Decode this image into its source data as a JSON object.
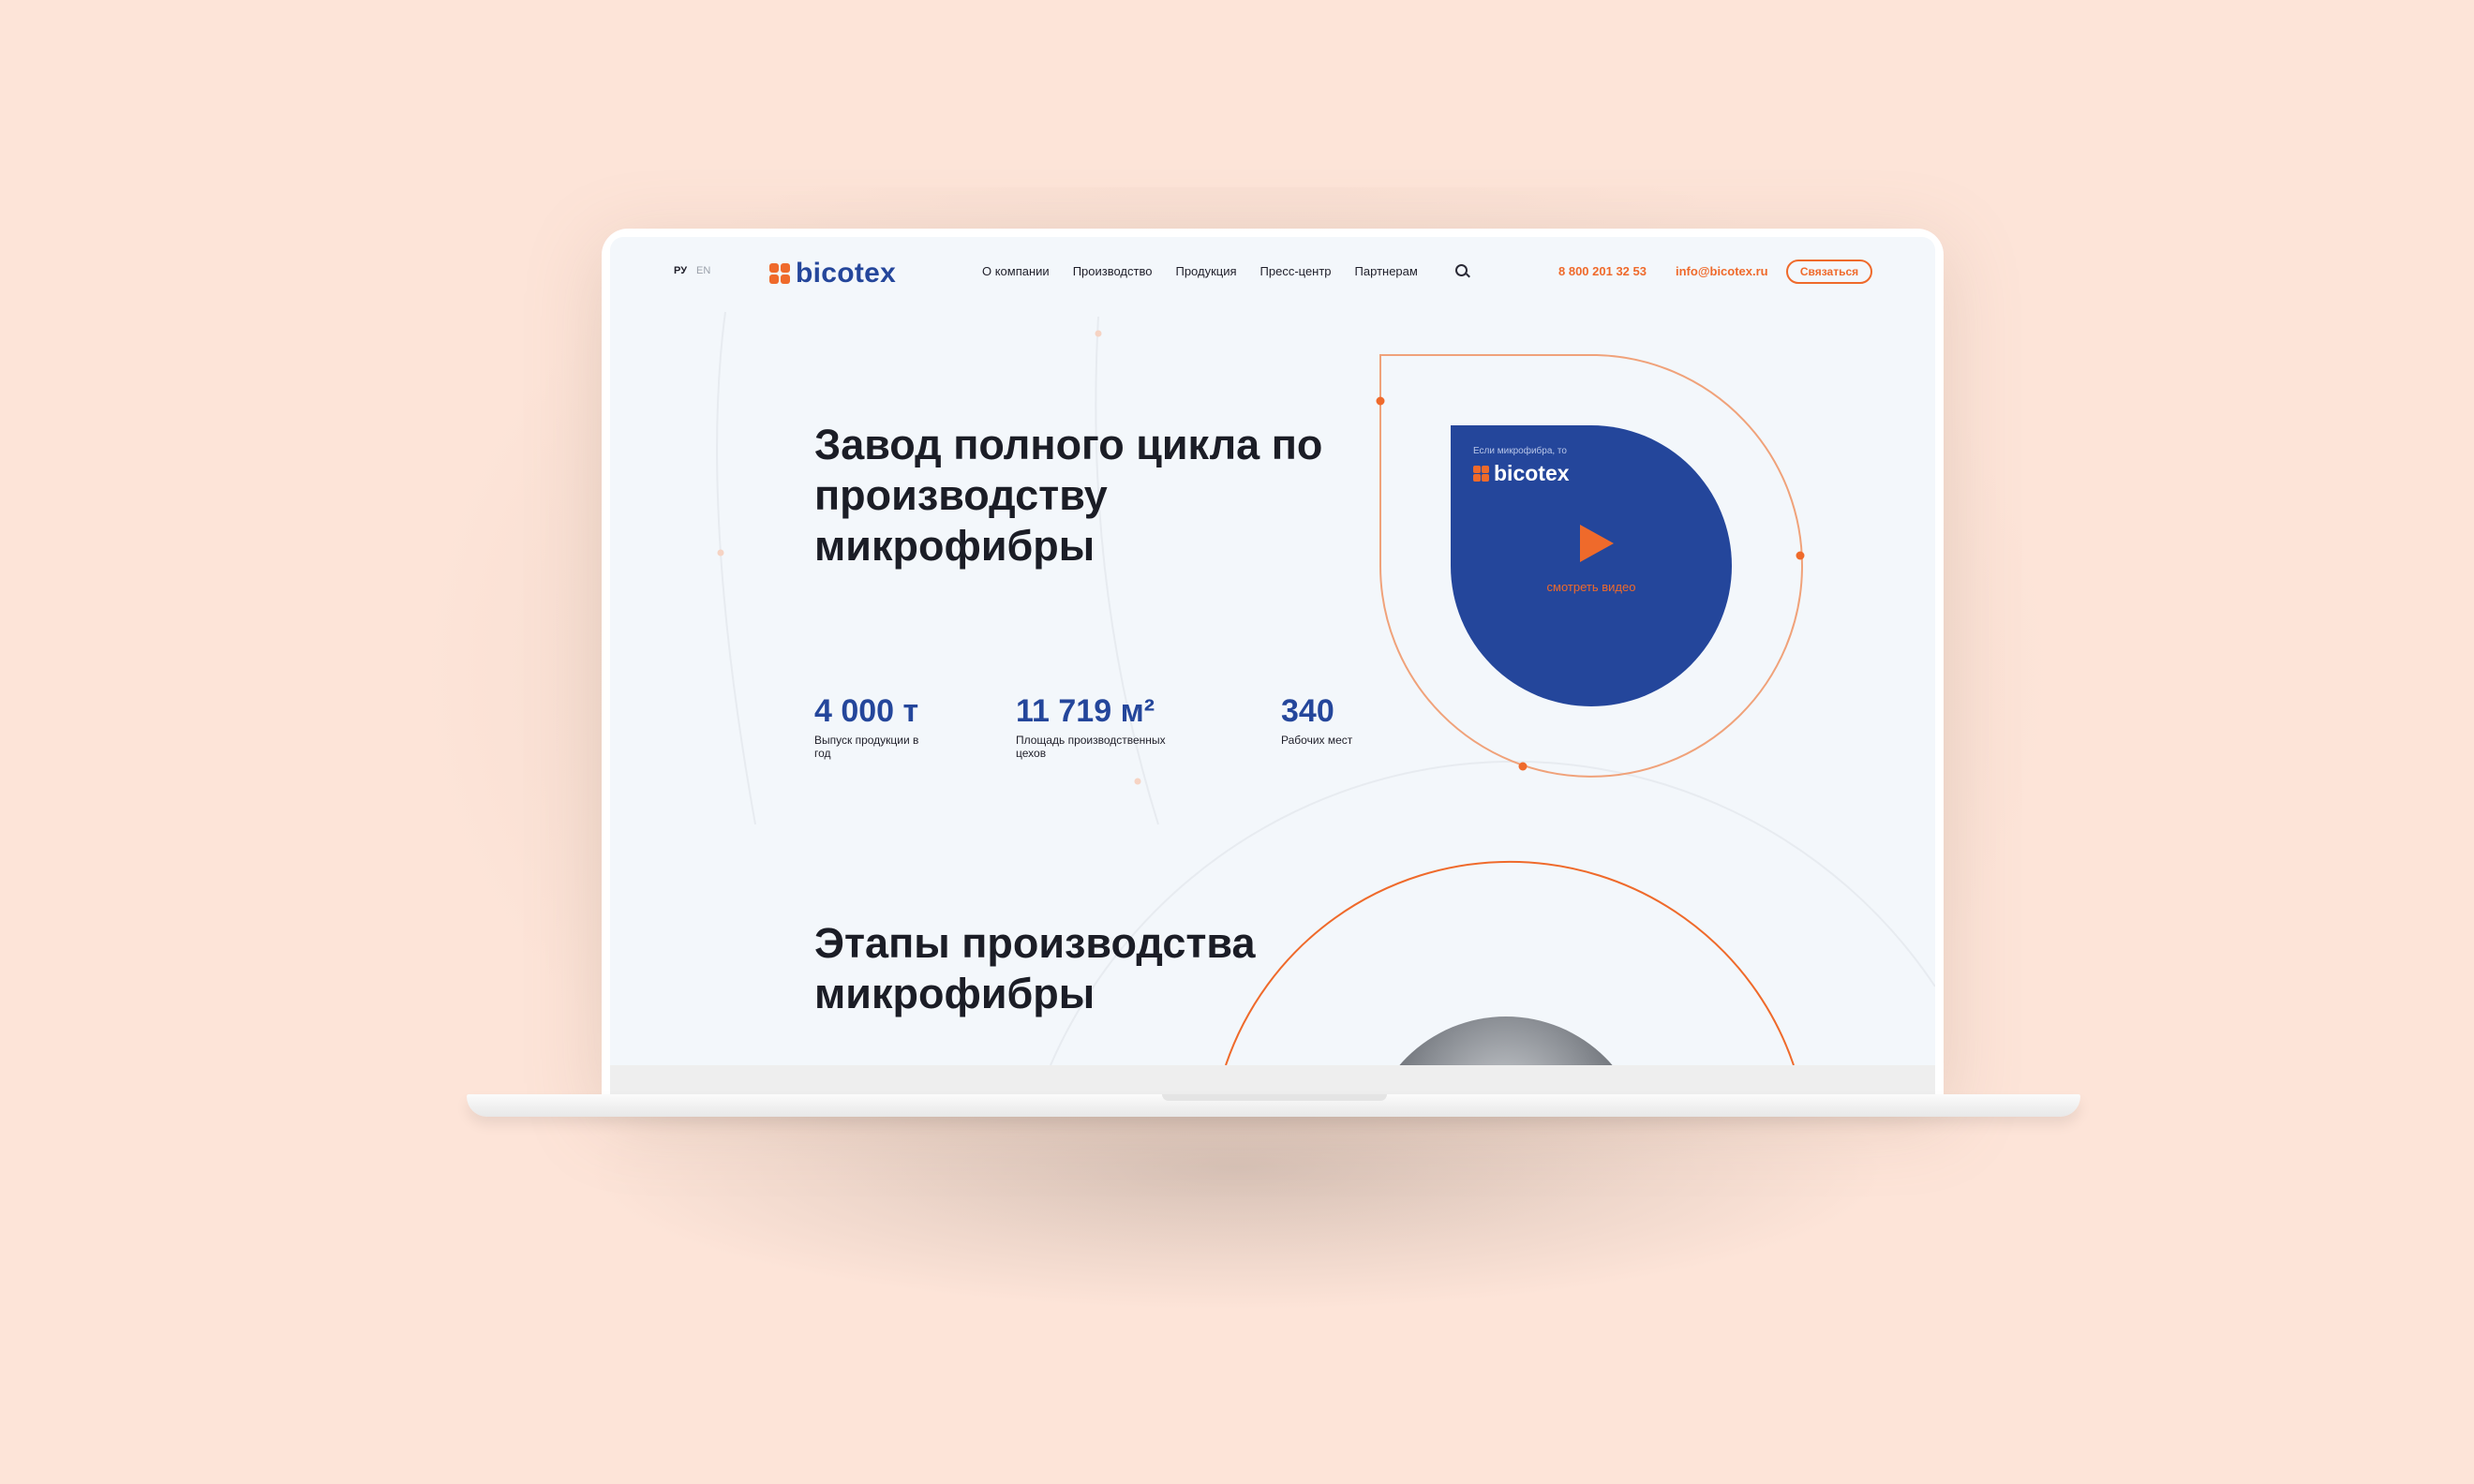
{
  "header": {
    "lang_ru": "РУ",
    "lang_en": "EN",
    "logo_text": "bicotex",
    "nav": [
      "О компании",
      "Производство",
      "Продукция",
      "Пресс-центр",
      "Партнерам"
    ],
    "search_icon": "search-icon",
    "phone": "8 800 201 32 53",
    "email": "info@bicotex.ru",
    "contact_button": "Связаться"
  },
  "hero": {
    "title": "Завод полного цикла по производству микрофибры",
    "stats": [
      {
        "value": "4 000 т",
        "label": "Выпуск продукции в год"
      },
      {
        "value": "11 719 м²",
        "label": "Площадь производственных цехов"
      },
      {
        "value": "340",
        "label": "Рабочих мест"
      }
    ]
  },
  "video": {
    "caption": "Если микрофибра, то",
    "logo_text": "bicotex",
    "play_icon": "play-icon",
    "watch_label": "смотреть видео"
  },
  "stages": {
    "title": "Этапы производства микрофибры"
  },
  "colors": {
    "background": "#fde4d8",
    "screen": "#f3f7fb",
    "brand_blue": "#24469b",
    "brand_orange": "#ef6a2b",
    "text": "#1b1d26"
  }
}
